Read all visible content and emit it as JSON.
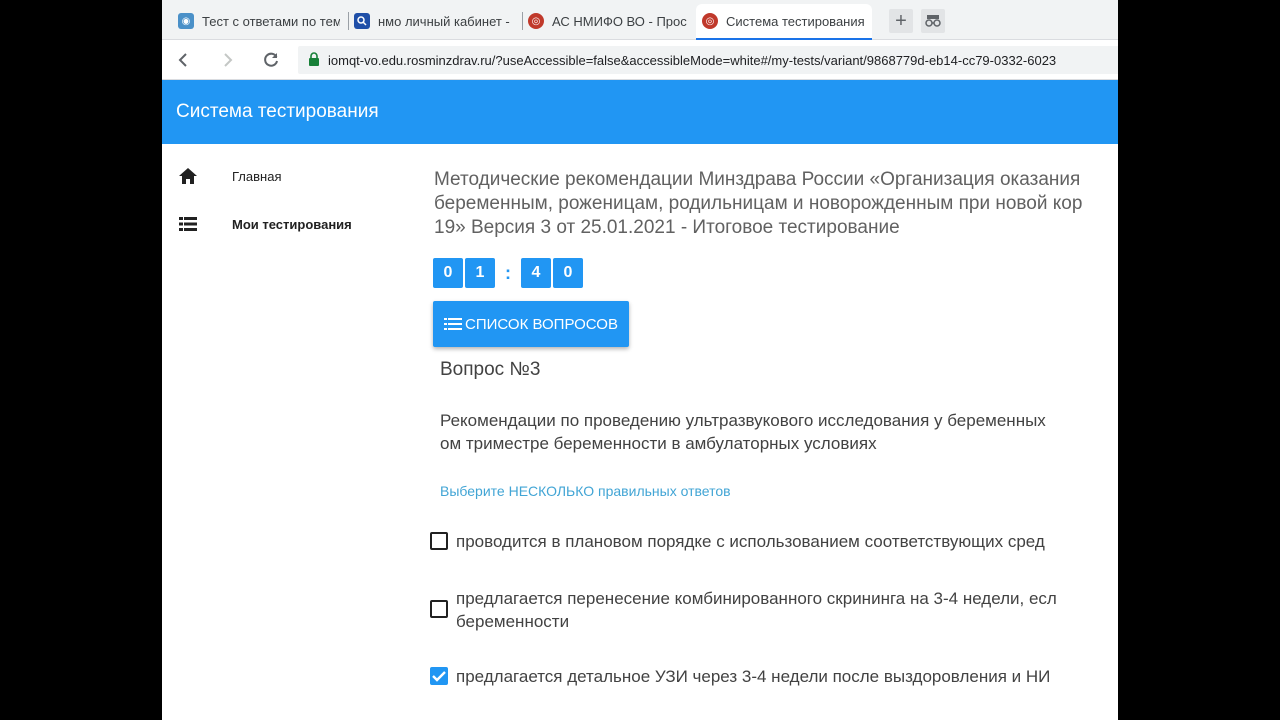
{
  "browser": {
    "tabs": [
      {
        "title": "Тест с ответами по тем"
      },
      {
        "title": "нмо личный кабинет -"
      },
      {
        "title": "АС НМИФО ВО - Прос"
      },
      {
        "title": "Система тестирования"
      }
    ],
    "url": "iomqt-vo.edu.rosminzdrav.ru/?useAccessible=false&accessibleMode=white#/my-tests/variant/9868779d-eb14-cc79-0332-6023"
  },
  "app": {
    "title": "Система тестирования",
    "accent": "#2196f3"
  },
  "sidebar": {
    "items": [
      {
        "label": "Главная",
        "icon": "home-icon"
      },
      {
        "label": "Мои тестирования",
        "icon": "list-icon"
      }
    ]
  },
  "test": {
    "title_lines": [
      "Методические рекомендации Минздрава России «Организация оказания",
      "беременным, роженицам, родильницам и новорожденным при новой кор",
      "19» Версия 3 от 25.01.2021 - Итоговое тестирование"
    ],
    "timer": {
      "d1": "0",
      "d2": "1",
      "sep": ":",
      "d3": "4",
      "d4": "0"
    },
    "question_list_label": "СПИСОК ВОПРОСОВ"
  },
  "question": {
    "number": "Вопрос №3",
    "text_lines": [
      "Рекомендации по проведению ультразвукового исследования у беременных",
      "ом триместре беременности в амбулаторных условиях"
    ],
    "hint": "Выберите НЕСКОЛЬКО правильных ответов",
    "answers": [
      {
        "lines": [
          "проводится в плановом порядке с использованием соответствующих сред"
        ],
        "checked": false
      },
      {
        "lines": [
          "предлагается перенесение комбинированного скрининга на 3-4 недели, есл",
          "беременности"
        ],
        "checked": false
      },
      {
        "lines": [
          "предлагается детальное УЗИ через 3-4 недели после выздоровления и НИ"
        ],
        "checked": true
      }
    ]
  }
}
